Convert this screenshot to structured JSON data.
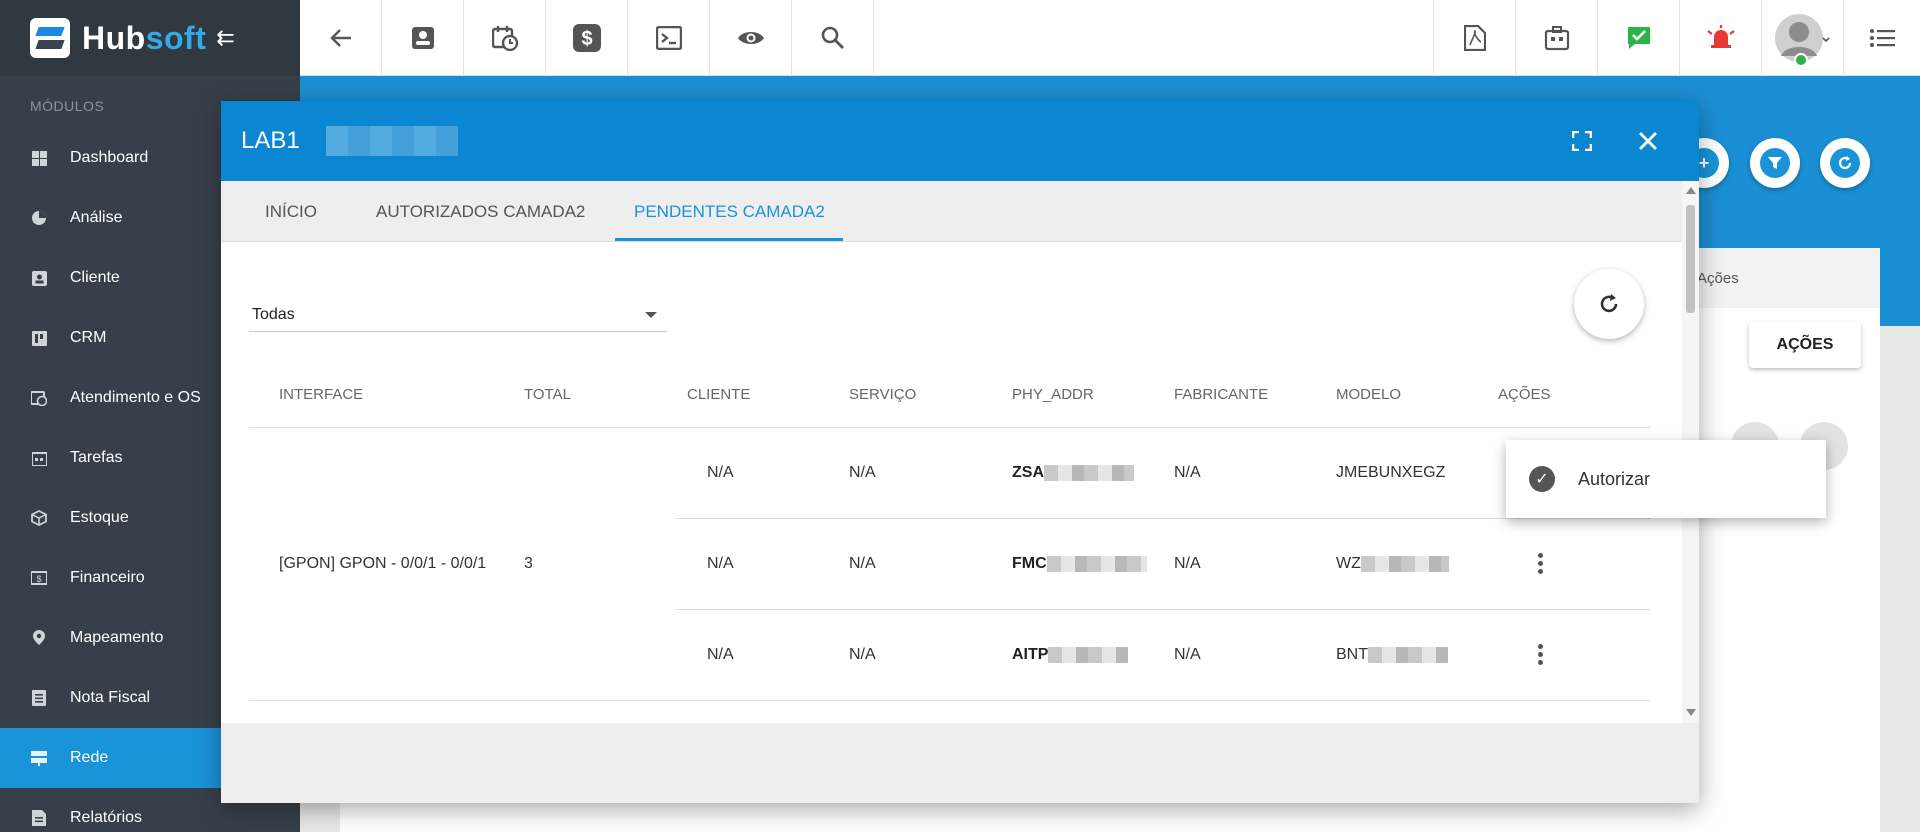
{
  "app": {
    "name_part1": "Hub",
    "name_part2": "soft",
    "brand_color": "#1a94d9",
    "sidebar_color": "#37404a"
  },
  "sidebar": {
    "section_label": "MÓDULOS",
    "items": [
      {
        "label": "Dashboard",
        "icon": "dashboard-icon"
      },
      {
        "label": "Análise",
        "icon": "pie-chart-icon"
      },
      {
        "label": "Cliente",
        "icon": "contact-card-icon"
      },
      {
        "label": "CRM",
        "icon": "kanban-icon"
      },
      {
        "label": "Atendimento e OS",
        "icon": "calendar-clock-icon"
      },
      {
        "label": "Tarefas",
        "icon": "calendar-icon"
      },
      {
        "label": "Estoque",
        "icon": "box-icon"
      },
      {
        "label": "Financeiro",
        "icon": "money-icon"
      },
      {
        "label": "Mapeamento",
        "icon": "map-pin-icon"
      },
      {
        "label": "Nota Fiscal",
        "icon": "document-icon"
      },
      {
        "label": "Rede",
        "icon": "server-icon",
        "active": true
      },
      {
        "label": "Relatórios",
        "icon": "report-icon"
      }
    ]
  },
  "background_page": {
    "acoes_header": "Ações",
    "acoes_button": "AÇÕES"
  },
  "modal": {
    "title": "LAB1",
    "tabs": [
      "INÍCIO",
      "AUTORIZADOS CAMADA2",
      "PENDENTES CAMADA2"
    ],
    "active_tab": "PENDENTES CAMADA2",
    "filter_value": "Todas",
    "columns": [
      "INTERFACE",
      "TOTAL",
      "CLIENTE",
      "SERVIÇO",
      "PHY_ADDR",
      "FABRICANTE",
      "MODELO",
      "AÇÕES"
    ],
    "group": {
      "interface": "[GPON] GPON - 0/0/1 - 0/0/1",
      "total": "3"
    },
    "rows": [
      {
        "cliente": "N/A",
        "servico": "N/A",
        "phy_addr": "ZSA",
        "fabricante": "N/A",
        "modelo": "JMEBUNXEGZ"
      },
      {
        "cliente": "N/A",
        "servico": "N/A",
        "phy_addr": "FMC",
        "fabricante": "N/A",
        "modelo": "WZ"
      },
      {
        "cliente": "N/A",
        "servico": "N/A",
        "phy_addr": "AITP",
        "fabricante": "N/A",
        "modelo": "BNT"
      }
    ]
  },
  "popup_menu": {
    "item_label": "Autorizar"
  }
}
